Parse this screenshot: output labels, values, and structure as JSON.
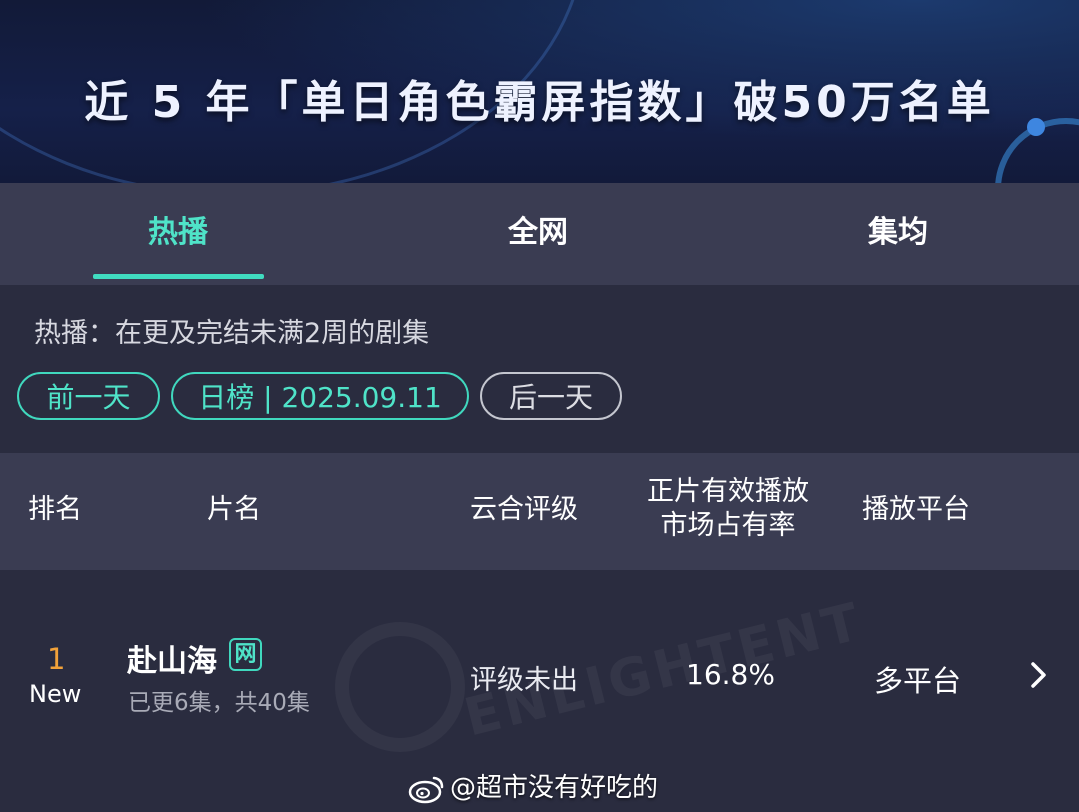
{
  "banner": {
    "title": "近 5 年「单日角色霸屏指数」破50万名单"
  },
  "tabs": [
    {
      "label": "热播",
      "active": true
    },
    {
      "label": "全网",
      "active": false
    },
    {
      "label": "集均",
      "active": false
    }
  ],
  "filter": {
    "description": "热播：在更及完结未满2周的剧集",
    "prev_label": "前一天",
    "date_label": "日榜 | 2025.09.11",
    "next_label": "后一天"
  },
  "table": {
    "headers": {
      "rank": "排名",
      "title": "片名",
      "grade": "云合评级",
      "share": "正片有效播放\n市场占有率",
      "platform": "播放平台"
    },
    "rows": [
      {
        "rank": "1",
        "rank_tag": "New",
        "title": "赴山海",
        "badge": "网",
        "episodes": "已更6集，共40集",
        "grade": "评级未出",
        "share": "16.8%",
        "platform": "多平台"
      }
    ]
  },
  "credit": {
    "text": "@超市没有好吃的",
    "icon": "weibo-icon"
  },
  "colors": {
    "accent": "#40dcc0",
    "rank_orange": "#f2a23a",
    "panel": "#3a3c52",
    "background": "#2a2c3f",
    "banner": "#141c3e"
  }
}
